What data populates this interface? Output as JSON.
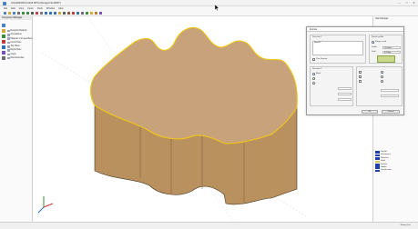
{
  "window": {
    "title": "SOLIDWORKS 2018 SP5.0 [Design2.SLDPRT]",
    "controls": [
      "—",
      "□",
      "✕"
    ]
  },
  "menu": [
    "File",
    "Edit",
    "View",
    "Insert",
    "Tools",
    "Window",
    "Help"
  ],
  "toolbar": {
    "icons": [
      {
        "name": "new-icon",
        "color": "#4a7fc1"
      },
      {
        "name": "open-icon",
        "color": "#d4a838"
      },
      {
        "name": "save-icon",
        "color": "#4a7fc1"
      },
      {
        "name": "print-icon",
        "color": "#6c6c6c"
      },
      {
        "name": "undo-icon",
        "color": "#3a8c3a"
      },
      {
        "name": "redo-icon",
        "color": "#3a8c3a"
      },
      {
        "name": "select-icon",
        "color": "#555555"
      },
      {
        "name": "rebuild-icon",
        "color": "#c23b3b"
      },
      {
        "name": "options-icon",
        "color": "#777777"
      },
      {
        "name": "zoom-icon",
        "color": "#2f6fb3"
      },
      {
        "name": "rotate-icon",
        "color": "#2f6fb3"
      },
      {
        "name": "pan-icon",
        "color": "#2f6fb3"
      },
      {
        "name": "section-icon",
        "color": "#d4a838"
      },
      {
        "name": "view-orient-icon",
        "color": "#5b5b5b"
      },
      {
        "name": "display-style-icon",
        "color": "#8a5a2b"
      },
      {
        "name": "appearance-icon",
        "color": "#c23b3b"
      },
      {
        "name": "scene-icon",
        "color": "#2f6fb3"
      },
      {
        "name": "measure-icon",
        "color": "#6c6c6c"
      },
      {
        "name": "sketch-icon",
        "color": "#3a8c3a"
      },
      {
        "name": "extrude-icon",
        "color": "#d4a838"
      },
      {
        "name": "fillet-icon",
        "color": "#c27a2b"
      },
      {
        "name": "shell-icon",
        "color": "#7a4fb3"
      }
    ]
  },
  "left_panel": {
    "title": "Component Manager",
    "tree": [
      "Design2 (Default)",
      "Annotations",
      "Material <not specified>",
      "Front Plane",
      "Top Plane",
      "Right Plane",
      "Origin",
      "Boss-Extrude1"
    ]
  },
  "dialog": {
    "title": "Extrude",
    "from_label": "Direction 1",
    "list_label": "Sketch1",
    "profile_label": "Sketch profile",
    "merge_label": "Merge result",
    "thin_label": "Thin Feature",
    "dir_label": "Direction 2",
    "type_label": "Blind",
    "depth_label": "Depth",
    "depth_value": "10.00mm",
    "draft_label": "Draft",
    "draft_value": "0.00deg",
    "ok_label": "OK",
    "cancel_label": "Cancel"
  },
  "right_panel": {
    "title": "Task Manager"
  },
  "layers": [
    {
      "name": "Default",
      "color": "#1f3fb0"
    },
    {
      "name": "Dimensions",
      "color": "#1f3fb0"
    },
    {
      "name": "Sketches",
      "color": "#1f3fb0"
    },
    {
      "name": "Solid",
      "color": "#d8c85a"
    },
    {
      "name": "Surface",
      "color": "#1f3fb0"
    },
    {
      "name": "Hidden",
      "color": "#1f3fb0"
    },
    {
      "name": "Construction",
      "color": "#1f3fb0"
    }
  ],
  "status": {
    "text": "Editing Part"
  },
  "colors": {
    "part_top": "#c8a27a",
    "part_side": "#b8915f",
    "edge_highlight": "#f0c818"
  }
}
